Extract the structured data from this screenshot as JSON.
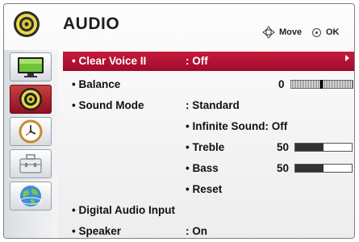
{
  "header": {
    "title": "AUDIO",
    "move_label": "Move",
    "ok_label": "OK"
  },
  "sidebar": {
    "tabs": [
      {
        "name": "picture",
        "icon": "tv-screen-icon",
        "active": false
      },
      {
        "name": "audio",
        "icon": "speaker-icon",
        "active": true
      },
      {
        "name": "time",
        "icon": "clock-icon",
        "active": false
      },
      {
        "name": "option",
        "icon": "toolbox-icon",
        "active": false
      },
      {
        "name": "network",
        "icon": "globe-icon",
        "active": false
      }
    ]
  },
  "menu": {
    "clear_voice": {
      "label": "• Clear Voice II",
      "value": ": Off"
    },
    "balance": {
      "label": "• Balance",
      "value": "0",
      "level": 0
    },
    "sound_mode": {
      "label": "• Sound Mode",
      "value": ": Standard"
    },
    "infinite_sound": {
      "label": "• Infinite Sound: Off"
    },
    "treble": {
      "label": "• Treble",
      "value": "50",
      "percent": 50
    },
    "bass": {
      "label": "• Bass",
      "value": "50",
      "percent": 50
    },
    "reset": {
      "label": "• Reset"
    },
    "digital_audio_input": {
      "label": "• Digital Audio Input"
    },
    "speaker": {
      "label": "• Speaker",
      "value": ": On"
    }
  },
  "colors": {
    "selected_row": "#b3122f",
    "active_tab": "#9a1226"
  }
}
